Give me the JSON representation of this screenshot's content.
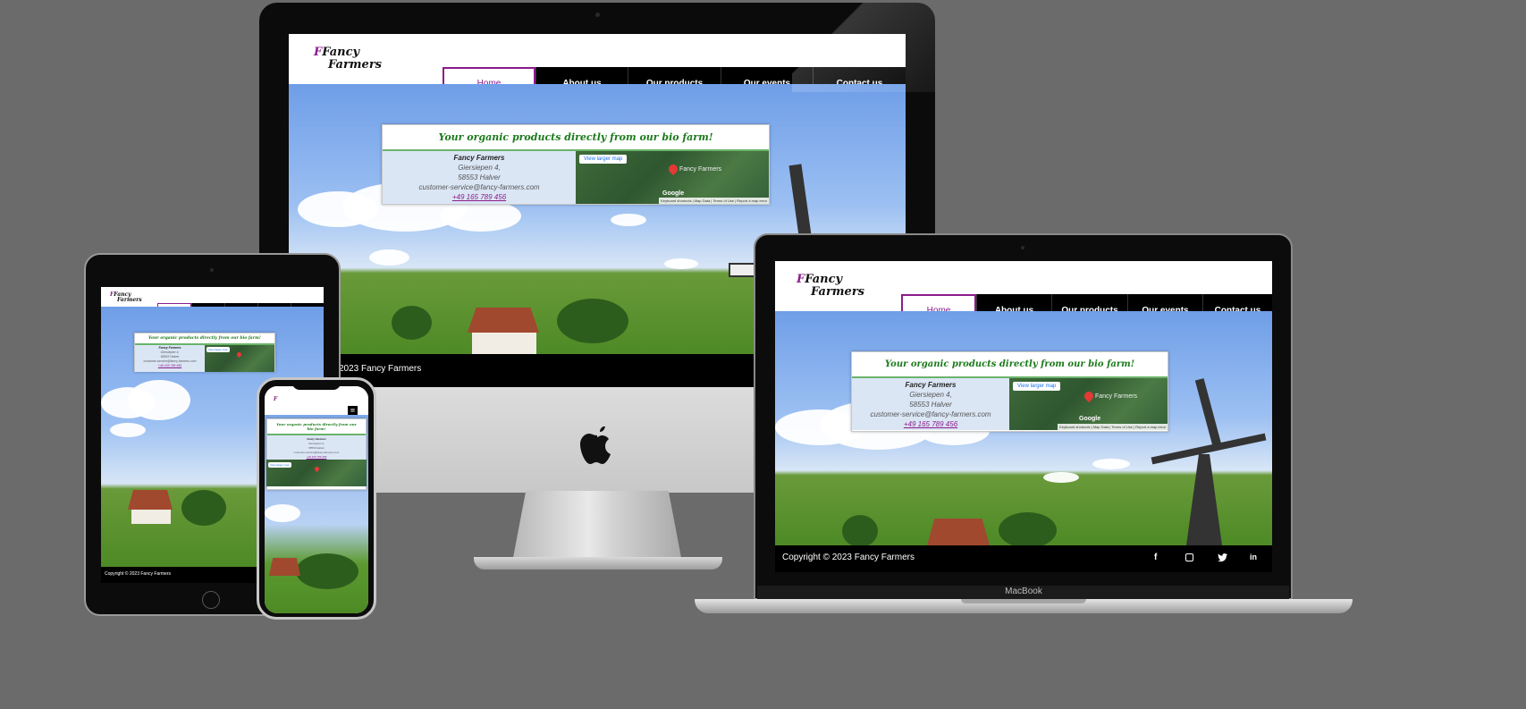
{
  "site": {
    "logo_line1": "Fancy",
    "logo_line2": "Farmers",
    "nav": [
      "Home",
      "About us",
      "Our products",
      "Our events",
      "Contact us"
    ],
    "card_title": "Your organic products directly from our bio farm!",
    "address": {
      "name": "Fancy Farmers",
      "street": "Giersiepen 4,",
      "city": "58553 Halver",
      "email": "customer-service@fancy-farmers.com",
      "phone": "+49 165 789 456"
    },
    "map": {
      "button": "View larger map",
      "place": "Fancy Farmers",
      "google": "Google",
      "footer": "Keyboard shortcuts | Map Data | Terms of Use | Report a map error"
    },
    "footer_copy": "Copyright © 2023 Fancy Farmers",
    "social_icons": [
      "facebook-icon",
      "instagram-icon",
      "twitter-icon",
      "linkedin-icon"
    ]
  },
  "devices": {
    "imac_footer_visible": "2023 Fancy Farmers",
    "macbook_label": "MacBook"
  },
  "colors": {
    "accent": "#8b1c8b",
    "title_green": "#1b7a1b",
    "background": "#6b6b6b"
  }
}
